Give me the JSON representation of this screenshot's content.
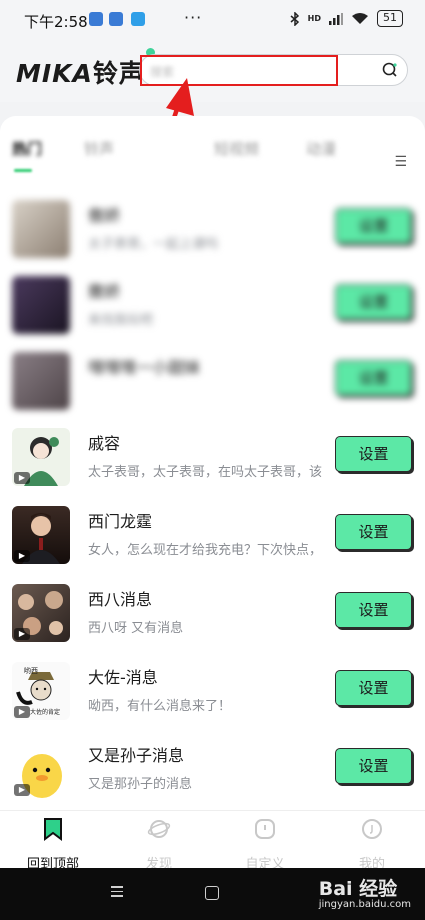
{
  "status_bar": {
    "time": "下午2:58",
    "more": "···",
    "signal": "HD",
    "battery": "51"
  },
  "header": {
    "logo": "MIKA",
    "logo_cn": "铃声",
    "search_placeholder": "搜索"
  },
  "tabs": [
    {
      "label": "热门"
    },
    {
      "label": "铃声"
    },
    {
      "label": "短视频"
    },
    {
      "label": "动漫"
    }
  ],
  "list": [
    {
      "name": "傲娇",
      "desc": "太子表哥，一起上课吗",
      "button": "设置"
    },
    {
      "name": "撒娇",
      "desc": "来找我玩吧",
      "button": "设置"
    },
    {
      "name": "嘿嘿嘿一小甜妹",
      "desc": "",
      "button": "设置"
    },
    {
      "name": "戚容",
      "desc": "太子表哥，太子表哥，在吗太子表哥，该",
      "button": "设置"
    },
    {
      "name": "西门龙霆",
      "desc": "女人，怎么现在才给我充电？下次快点，",
      "button": "设置"
    },
    {
      "name": "西八消息",
      "desc": "西八呀 又有消息",
      "button": "设置"
    },
    {
      "name": "大佐-消息",
      "desc": "呦西，有什么消息来了！",
      "thumb_caption_top": "哟西",
      "thumb_caption": "大佐的肯定",
      "button": "设置"
    },
    {
      "name": "又是孙子消息",
      "desc": "又是那孙子的消息",
      "button": "设置"
    }
  ],
  "bottom_nav": [
    {
      "label": "回到顶部"
    },
    {
      "label": "发现"
    },
    {
      "label": "自定义"
    },
    {
      "label": "我的"
    }
  ],
  "watermark": {
    "main": "Bai 经验",
    "sub": "jingyan.baidu.com"
  },
  "colors": {
    "accent": "#5ce8a6",
    "highlight": "#e41e1e",
    "tab_indicator": "#2ecc71"
  }
}
